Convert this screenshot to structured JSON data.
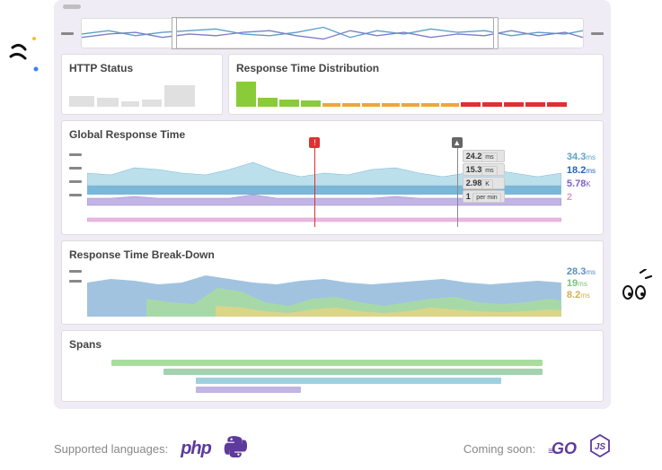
{
  "panels": {
    "http_status": {
      "title": "HTTP Status"
    },
    "resp_dist": {
      "title": "Response Time Distribution"
    },
    "grt": {
      "title": "Global Response Time",
      "readout": [
        "24.2",
        "15.3",
        "2.98",
        "1"
      ],
      "readout_suffix": [
        "ms",
        "ms",
        "K",
        "per min"
      ],
      "values": [
        "34.3",
        "18.2",
        "5.78",
        "2"
      ],
      "values_suffix": [
        "ms",
        "ms",
        "K",
        ""
      ]
    },
    "rtbd": {
      "title": "Response Time Break-Down",
      "values": [
        "28.3",
        "19",
        "8.2"
      ],
      "values_suffix": [
        "ms",
        "ms",
        "ms"
      ]
    },
    "spans": {
      "title": "Spans"
    }
  },
  "footer": {
    "supported_label": "Supported languages:",
    "coming_label": "Coming soon:",
    "php": "php",
    "go": "GO"
  },
  "chart_data": {
    "http_status": {
      "type": "bar",
      "values": [
        12,
        10,
        6,
        8,
        24
      ],
      "title": "HTTP Status"
    },
    "response_time_distribution": {
      "type": "bar",
      "series": [
        {
          "name": "green",
          "color": "#8acb3a",
          "values": [
            28,
            10,
            8,
            7
          ]
        },
        {
          "name": "orange",
          "color": "#f2a43a",
          "values": [
            4,
            4,
            4,
            4,
            4,
            4,
            4
          ]
        },
        {
          "name": "red",
          "color": "#e03030",
          "values": [
            5,
            5,
            5,
            5,
            5
          ]
        }
      ],
      "title": "Response Time Distribution"
    },
    "global_response_time": {
      "type": "area",
      "series": [
        {
          "name": "layer1",
          "color": "#bcdfec",
          "values": [
            26,
            24,
            30,
            28,
            26,
            25,
            30,
            34,
            28,
            24,
            26,
            25,
            28,
            30,
            26,
            24,
            26,
            28,
            26,
            24
          ],
          "label": "34.3ms"
        },
        {
          "name": "layer2",
          "color": "#7ab7d8",
          "values": [
            14,
            13,
            16,
            15,
            14,
            13,
            15,
            18,
            15,
            13,
            14,
            13,
            15,
            16,
            14,
            13,
            14,
            15,
            14,
            13
          ],
          "label": "18.2ms"
        },
        {
          "name": "layer3",
          "color": "#c2b4e5",
          "values": [
            5,
            5,
            6,
            5,
            5,
            5,
            5,
            7,
            5,
            5,
            5,
            5,
            5,
            6,
            5,
            5,
            5,
            5,
            5,
            5
          ],
          "label": "5.78K"
        },
        {
          "name": "layer4",
          "color": "#e8b9e0",
          "values": [
            1,
            1,
            1,
            1,
            1,
            1,
            1,
            2,
            1,
            1,
            1,
            1,
            1,
            1,
            1,
            1,
            1,
            1,
            1,
            1
          ],
          "label": "2"
        }
      ],
      "markers": [
        {
          "type": "alert",
          "position_pct": 48,
          "color": "#e03030"
        },
        {
          "type": "deploy",
          "position_pct": 78,
          "color": "#666"
        }
      ],
      "title": "Global Response Time"
    },
    "response_time_breakdown": {
      "type": "area",
      "series": [
        {
          "name": "blue",
          "color": "#91b8db",
          "values": [
            20,
            24,
            22,
            18,
            20,
            26,
            24,
            20,
            18,
            22,
            24,
            20,
            18,
            20,
            22,
            24,
            20,
            18,
            20,
            22
          ],
          "label": "28.3ms"
        },
        {
          "name": "green",
          "color": "#a8dd9d",
          "values": [
            0,
            0,
            14,
            10,
            8,
            18,
            16,
            10,
            6,
            12,
            14,
            10,
            6,
            10,
            12,
            14,
            10,
            8,
            10,
            12
          ],
          "label": "19ms"
        },
        {
          "name": "yellow",
          "color": "#e4d483",
          "values": [
            0,
            0,
            0,
            0,
            0,
            8,
            6,
            4,
            2,
            5,
            6,
            4,
            2,
            4,
            5,
            6,
            4,
            3,
            4,
            5
          ],
          "label": "8.2ms"
        }
      ],
      "title": "Response Time Break-Down"
    },
    "spans": {
      "type": "bar",
      "bars": [
        {
          "start_pct": 8,
          "width_pct": 82,
          "color": "#a8dd9d"
        },
        {
          "start_pct": 18,
          "width_pct": 72,
          "color": "#a3d2b0"
        },
        {
          "start_pct": 24,
          "width_pct": 58,
          "color": "#9ed0e0"
        },
        {
          "start_pct": 24,
          "width_pct": 20,
          "color": "#c2b4e5"
        }
      ],
      "title": "Spans"
    },
    "timeline": {
      "type": "line",
      "series": [
        {
          "name": "a",
          "color": "#5a9fc8",
          "values": [
            18,
            14,
            20,
            16,
            14,
            12,
            18,
            20,
            16,
            10,
            22,
            14,
            18,
            12,
            16,
            14,
            20,
            16,
            18,
            14
          ]
        },
        {
          "name": "b",
          "color": "#7a7fc8",
          "values": [
            22,
            18,
            16,
            22,
            18,
            20,
            16,
            14,
            20,
            24,
            14,
            20,
            16,
            22,
            18,
            20,
            14,
            20,
            16,
            22
          ]
        }
      ],
      "selection": {
        "start_pct": 18,
        "end_pct": 82
      }
    }
  }
}
